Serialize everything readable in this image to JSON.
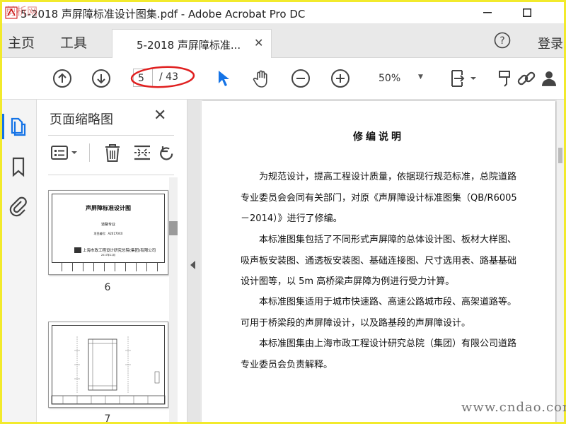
{
  "window": {
    "title": "5-2018 声屏障标准设计图集.pdf - Adobe Acrobat Pro DC",
    "logo_text": "剪析网"
  },
  "tabs": {
    "home": "主页",
    "tools": "工具",
    "doc_tab": "5-2018 声屏障标准...",
    "login": "登录"
  },
  "toolbar": {
    "current_page": "5",
    "total_pages": "/ 43",
    "zoom": "50%"
  },
  "thumbnails": {
    "title": "页面缩略图",
    "pages": [
      {
        "number": "6",
        "heading": "声屏障标准设计图",
        "sub": "道路专业",
        "code": "项目编号：A20170XX",
        "org": "上海市政工程设计研究总院(集团)有限公司",
        "date": "2017年12月"
      },
      {
        "number": "7"
      }
    ]
  },
  "document": {
    "heading": "修编说明",
    "paragraphs": [
      "为规范设计，提高工程设计质量，依据现行规范标准，总院道路专业委员会会同有关部门，对原《声屏障设计标准图集（QB/R6005－2014）》进行了修编。",
      "本标准图集包括了不同形式声屏障的总体设计图、板材大样图、吸声板安装图、通透板安装图、基础连接图、尺寸选用表、路基基础设计图等，以 5m 高桥梁声屏障为例进行受力计算。",
      "本标准图集适用于城市快速路、高速公路城市段、高架道路等。可用于桥梁段的声屏障设计，以及路基段的声屏障设计。",
      "本标准图集由上海市政工程设计研究总院（集团）有限公司道路专业委员会负责解释。"
    ]
  },
  "watermark": "www.cndao.com",
  "colors": {
    "accent": "#1473e6",
    "highlight": "#e02020",
    "frame": "#f2ea2c"
  }
}
